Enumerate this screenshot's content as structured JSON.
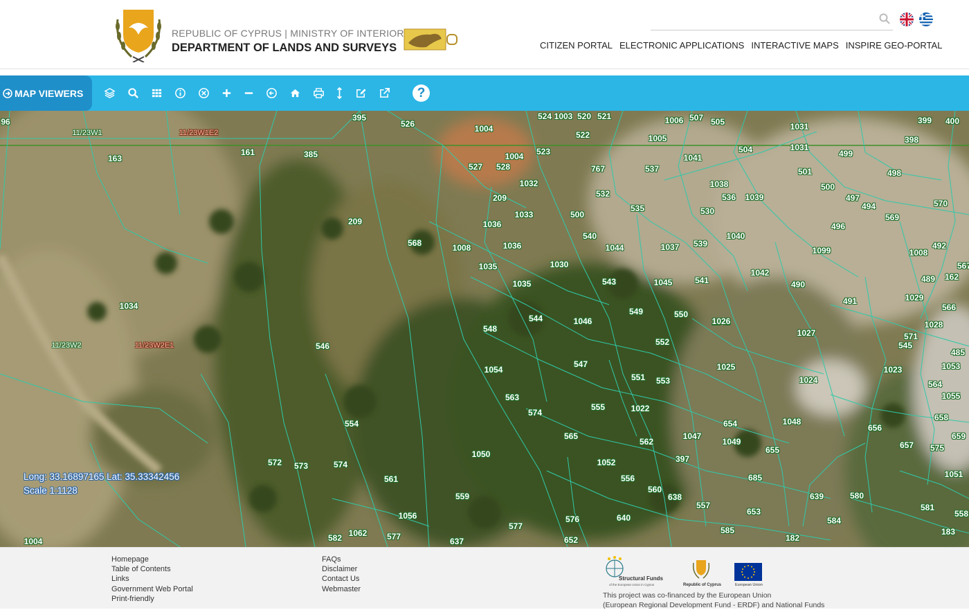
{
  "header": {
    "brand_top": "REPUBLIC OF CYPRUS | MINISTRY OF INTERIOR",
    "brand_main": "DEPARTMENT OF LANDS AND SURVEYS",
    "search_placeholder": "",
    "nav": [
      "CITIZEN PORTAL",
      "ELECTRONIC APPLICATIONS",
      "INTERACTIVE MAPS",
      "INSPIRE GEO-PORTAL"
    ],
    "languages": [
      "en-flag-icon",
      "gr-flag-icon"
    ]
  },
  "toolbar": {
    "map_viewers_label": "MAP VIEWERS",
    "tools": [
      "layers-icon",
      "search-icon",
      "grid-icon",
      "info-icon",
      "clear-icon",
      "zoom-in-icon",
      "zoom-out-icon",
      "back-icon",
      "home-icon",
      "print-icon",
      "measure-icon",
      "edit-icon",
      "share-icon"
    ],
    "help_label": "?"
  },
  "map": {
    "coordinates_text": "Long: 33.16897165 Lat: 35.33342456",
    "scale_text": "Scale 1:1128",
    "sheet_labels": [
      "11/23W1",
      "11/23W1E2",
      "11/23W2",
      "11/23W2E1"
    ],
    "parcels": [
      "96",
      "395",
      "526",
      "1004",
      "524",
      "1003",
      "520",
      "521",
      "1006",
      "507",
      "505",
      "1031",
      "399",
      "400",
      "398",
      "163",
      "161",
      "385",
      "522",
      "1005",
      "1004",
      "528",
      "523",
      "527",
      "767",
      "537",
      "1041",
      "504",
      "1031",
      "499",
      "1032",
      "501",
      "500",
      "498",
      "1038",
      "536",
      "1039",
      "209",
      "532",
      "535",
      "530",
      "1033",
      "500",
      "497",
      "494",
      "570",
      "209",
      "1036",
      "540",
      "1040",
      "496",
      "569",
      "568",
      "1008",
      "1036",
      "1044",
      "1037",
      "539",
      "1099",
      "492",
      "1008",
      "1035",
      "1030",
      "567",
      "1035",
      "543",
      "1045",
      "541",
      "1042",
      "490",
      "489",
      "162",
      "1034",
      "544",
      "1046",
      "549",
      "550",
      "1043",
      "491",
      "1029",
      "566",
      "548",
      "552",
      "1026",
      "1027",
      "1028",
      "571",
      "545",
      "546",
      "547",
      "551",
      "553",
      "1025",
      "1024",
      "1023",
      "1053",
      "485",
      "1054",
      "564",
      "563",
      "555",
      "1022",
      "1055",
      "574",
      "554",
      "1048",
      "654",
      "656",
      "658",
      "659",
      "565",
      "562",
      "1047",
      "1049",
      "655",
      "657",
      "575",
      "1050",
      "1052",
      "397",
      "572",
      "573",
      "574",
      "561",
      "556",
      "685",
      "1051",
      "560",
      "638",
      "639",
      "580",
      "559",
      "557",
      "653",
      "581",
      "1056",
      "577",
      "576",
      "640",
      "558",
      "584",
      "585",
      "582",
      "1062",
      "577",
      "637",
      "652",
      "182",
      "183",
      "1004"
    ]
  },
  "footer": {
    "col1": [
      "Homepage",
      "Table of Contents",
      "Links",
      "Government Web Portal",
      "Print-friendly"
    ],
    "col2": [
      "FAQs",
      "Disclaimer",
      "Contact Us",
      "Webmaster"
    ],
    "logo_captions": [
      "Structural Funds",
      "of the European Union in Cyprus",
      "Republic of Cyprus",
      "European Union"
    ],
    "funding_line1": "This project was co-financed by the European Union",
    "funding_line2": "(European Regional Development Fund - ERDF) and National Funds"
  },
  "colors": {
    "toolbar": "#2bb6e6",
    "map_viewers_tab": "#1f8fc9",
    "parcel_lines": "#2fc9a9",
    "sheet_line": "#3d8f2a"
  }
}
